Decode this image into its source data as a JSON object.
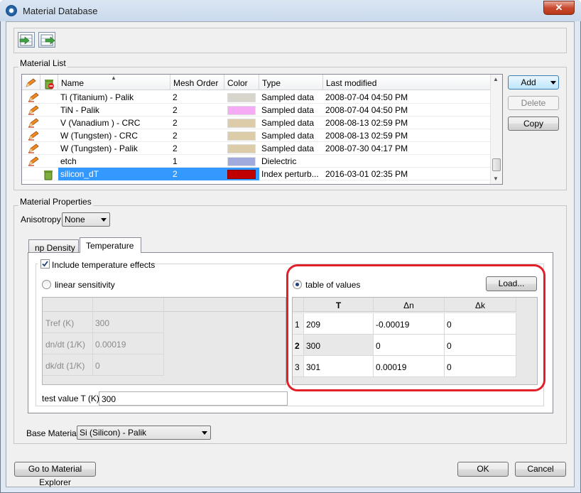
{
  "window": {
    "title": "Material Database",
    "close_glyph": "✕"
  },
  "toolbar": {
    "icons": [
      "import-icon",
      "export-icon"
    ]
  },
  "material_list": {
    "label": "Material List",
    "columns": [
      "Name",
      "Mesh Order",
      "Color",
      "Type",
      "Last modified"
    ],
    "rows": [
      {
        "name": "Ti (Titanium) - Palik",
        "mesh_order": "2",
        "color": "#d8d5cc",
        "type": "Sampled data",
        "modified": "2008-07-04 04:50 PM"
      },
      {
        "name": "TiN - Palik",
        "mesh_order": "2",
        "color": "#f5aaf5",
        "type": "Sampled data",
        "modified": "2008-07-04 04:50 PM"
      },
      {
        "name": "V (Vanadium ) - CRC",
        "mesh_order": "2",
        "color": "#dccca8",
        "type": "Sampled data",
        "modified": "2008-08-13 02:59 PM"
      },
      {
        "name": "W (Tungsten) - CRC",
        "mesh_order": "2",
        "color": "#dccca8",
        "type": "Sampled data",
        "modified": "2008-08-13 02:59 PM"
      },
      {
        "name": "W (Tungsten) - Palik",
        "mesh_order": "2",
        "color": "#dccca8",
        "type": "Sampled data",
        "modified": "2008-07-30 04:17 PM"
      },
      {
        "name": "etch",
        "mesh_order": "1",
        "color": "#a0aadc",
        "type": "Dielectric",
        "modified": ""
      },
      {
        "name": "silicon_dT",
        "mesh_order": "2",
        "color": "#c00000",
        "type": "Index perturb...",
        "modified": "2016-03-01 02:35 PM"
      }
    ],
    "buttons": {
      "add": "Add",
      "delete": "Delete",
      "copy": "Copy"
    }
  },
  "material_properties": {
    "label": "Material Properties",
    "anisotropy_label": "Anisotropy",
    "anisotropy_value": "None",
    "tabs": [
      "np Density",
      "Temperature"
    ],
    "include_temp_label": "Include temperature effects",
    "linear_label": "linear sensitivity",
    "table_label": "table of values",
    "load_button": "Load...",
    "linear_rows": [
      {
        "label": "Tref (K)",
        "value": "300"
      },
      {
        "label": "dn/dt (1/K)",
        "value": "0.00019"
      },
      {
        "label": "dk/dt (1/K)",
        "value": "0"
      }
    ],
    "table_headers": [
      "T",
      "Δn",
      "Δk"
    ],
    "table_rows": [
      {
        "idx": "1",
        "t": "209",
        "dn": "-0.00019",
        "dk": "0"
      },
      {
        "idx": "2",
        "t": "300",
        "dn": "0",
        "dk": "0"
      },
      {
        "idx": "3",
        "t": "301",
        "dn": "0.00019",
        "dk": "0"
      }
    ],
    "test_value_label": "test value T (K)",
    "test_value": "300",
    "base_material_label": "Base Material",
    "base_material_value": "Si (Silicon) - Palik"
  },
  "footer": {
    "explorer": "Go to Material Explorer",
    "ok": "OK",
    "cancel": "Cancel"
  },
  "colors": {
    "selection": "#3399ff",
    "highlight_ring": "#e0202a"
  }
}
